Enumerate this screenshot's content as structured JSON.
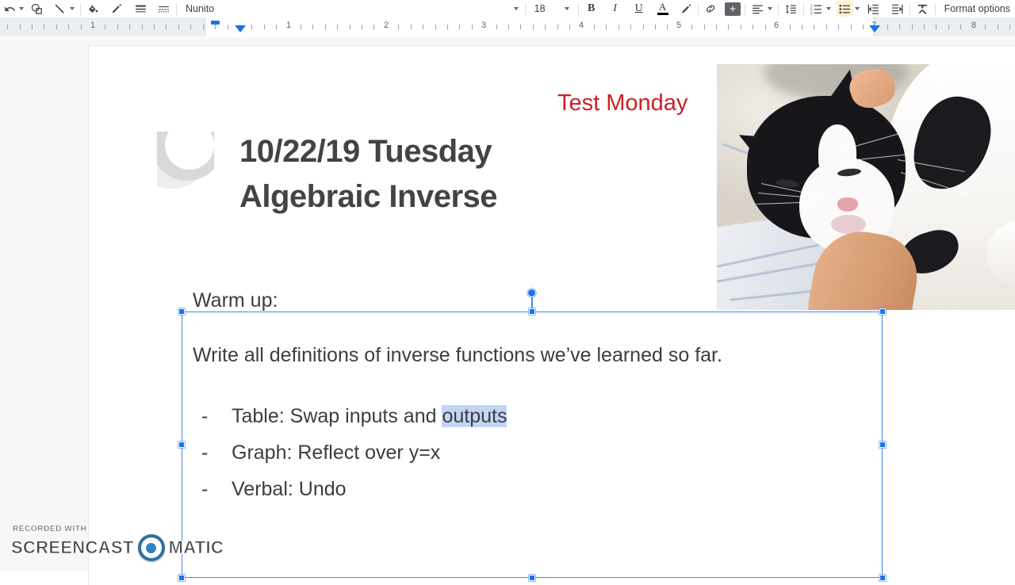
{
  "app": {
    "name": "Google Slides",
    "format_options_label": "Format options"
  },
  "toolbar": {
    "items": [
      {
        "name": "undo-icon",
        "label": "Undo"
      },
      {
        "name": "shape-icon",
        "label": "Shape"
      },
      {
        "name": "line-icon",
        "label": "Line"
      },
      {
        "name": "fill-color-icon",
        "label": "Fill color"
      },
      {
        "name": "border-color-icon",
        "label": "Border color"
      },
      {
        "name": "border-weight-icon",
        "label": "Border weight"
      },
      {
        "name": "border-dash-icon",
        "label": "Border dash"
      }
    ],
    "font_family": "Nunito",
    "font_size": "18",
    "bold_label": "B",
    "italic_label": "I",
    "underline_label": "U",
    "text_color_label": "A",
    "highlight_label": "Highlight color",
    "link_label": "Insert link",
    "comment_label": "Add comment",
    "align_label": "Align",
    "line_spacing_label": "Line spacing",
    "numbered_list_label": "Numbered list",
    "bulleted_list_label": "Bulleted list",
    "decrease_indent_label": "Decrease indent",
    "increase_indent_label": "Increase indent",
    "clear_formatting_label": "Clear formatting",
    "format_options": "Format options"
  },
  "ruler": {
    "numbers": [
      "1",
      "1",
      "2",
      "3",
      "4",
      "5",
      "6",
      "7",
      "8"
    ],
    "unit": "inches",
    "first_line_indent": "0.25",
    "left_indent": "0.5",
    "right_indent": "7.0"
  },
  "slide": {
    "eyebrow": "Test Monday",
    "eyebrow_color": "#cc2026",
    "title_line1": "10/22/19 Tuesday",
    "title_line2": "Algebraic Inverse",
    "title_color": "#434343",
    "image_alt": "photo of a black and white tuxedo cat lying on a blanket next to a person's arm",
    "body": {
      "line1": "Warm up:",
      "line2": "Write all definitions of inverse functions we’ve learned so far.",
      "bullets": [
        {
          "marker": "-",
          "text_before": "Table: Swap inputs and ",
          "selected": "outputs",
          "text_after": ""
        },
        {
          "marker": "-",
          "text_before": "Graph: Reflect over y=x",
          "selected": "",
          "text_after": ""
        },
        {
          "marker": "-",
          "text_before": "Verbal: Undo",
          "selected": "",
          "text_after": ""
        }
      ],
      "selection_highlight_color": "#c3d5f5",
      "text_color": "#3d3d3d"
    }
  },
  "selection": {
    "border_color": "#4285f4",
    "handle_color": "#1a73e8",
    "rotation_handle": "rotation-handle"
  },
  "watermark": {
    "line1": "RECORDED WITH",
    "word1": "SCREENCAST",
    "word2": "MATIC",
    "logo": "o-circle"
  }
}
